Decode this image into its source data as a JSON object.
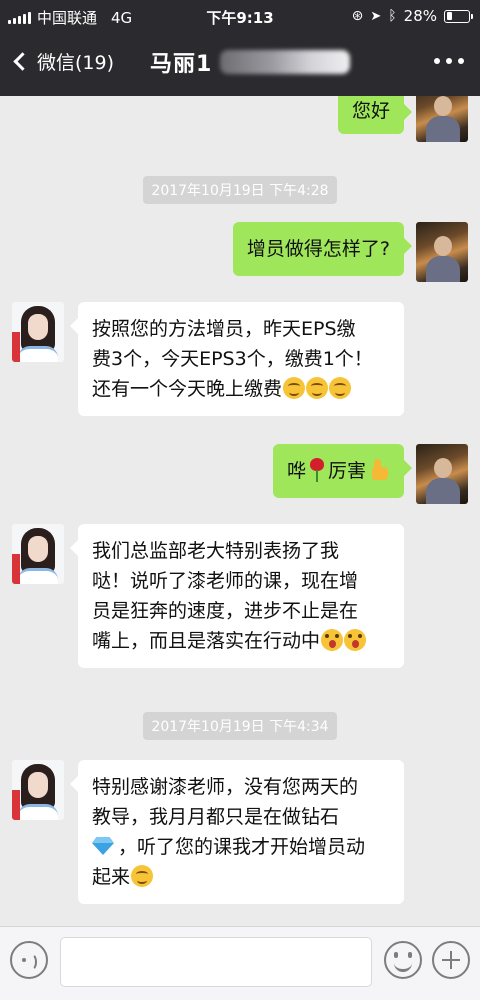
{
  "status_bar": {
    "carrier": "中国联通",
    "network": "4G",
    "time": "下午9:13",
    "battery": "28%",
    "battery_level": 0.28
  },
  "nav": {
    "back_label": "微信(19)",
    "title": "马丽1"
  },
  "messages": [
    {
      "side": "me",
      "text": "您好"
    },
    {
      "type": "timestamp",
      "text": "2017年10月19日 下午4:28"
    },
    {
      "side": "me",
      "text": "增员做得怎样了?"
    },
    {
      "side": "her",
      "lines": [
        "按照您的方法增员，昨天EPS缴",
        "费3个，今天EPS3个，缴费1个！",
        "还有一个今天晚上缴费"
      ],
      "trailing_emoji": [
        "smile-icon",
        "smile-icon",
        "smile-icon"
      ]
    },
    {
      "side": "me",
      "text_before": "哗",
      "text_after": "厉害",
      "emoji": [
        "rose-icon",
        "thumbs-up-icon"
      ]
    },
    {
      "side": "her",
      "lines": [
        "我们总监部老大特别表扬了我",
        "哒！说听了漆老师的课，现在增",
        "员是狂奔的速度，进步不止是在",
        "嘴上，而且是落实在行动中"
      ],
      "trailing_emoji": [
        "surprised-icon",
        "surprised-icon"
      ]
    },
    {
      "type": "timestamp",
      "text": "2017年10月19日 下午4:34"
    },
    {
      "side": "her",
      "lines": [
        "特别感谢漆老师，没有您两天的",
        "教导，我月月都只是在做钻石",
        "，听了您的课我才开始增员动",
        "起来"
      ],
      "emoji": [
        "diamond-icon",
        "smile-icon"
      ]
    }
  ],
  "colors": {
    "header_bg": "#2b2b2f",
    "my_bubble": "#9fe65a",
    "her_bubble": "#ffffff",
    "chat_bg": "#ebebeb"
  }
}
